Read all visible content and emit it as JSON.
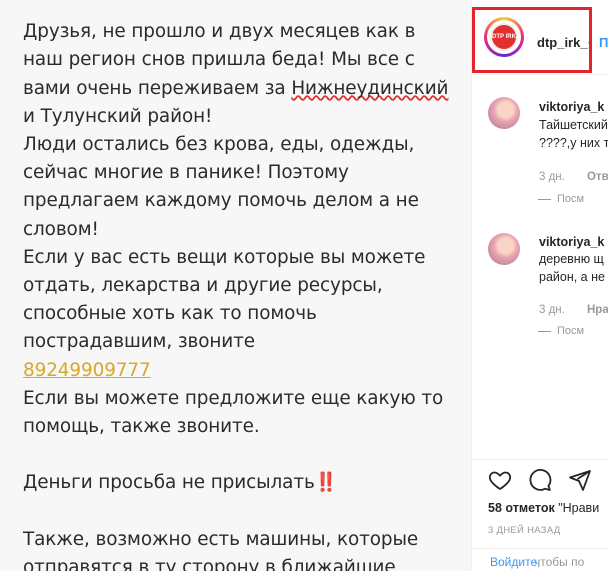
{
  "post": {
    "lines": [
      "Друзья, не прошло и двух месяцев как в",
      "наш регион снов пришла беда! Мы все с",
      "вами очень переживаем за ",
      "Нижнеудинский",
      "и Тулунский район!",
      "Люди остались без крова, еды, одежды,",
      "сейчас многие в панике! Поэтому",
      "предлагаем каждому помочь делом а не",
      "словом!",
      "Если у вас есть вещи которые вы можете",
      "отдать, лекарства и другие ресурсы,",
      "способные хоть как то помочь",
      "пострадавшим, звоните",
      "89249909777",
      "Если вы можете предложите еще какую то",
      "помощь, также звоните.",
      "Деньги просьба не присылать",
      "‼️",
      "Также, возможно есть машины, которые",
      "отправятся в ту сторону в ближайшие"
    ]
  },
  "header": {
    "username": "dtp_irk_",
    "separator": "•",
    "follow_label": "П",
    "avatar_logo_text": "DTP IRK"
  },
  "comments": [
    {
      "username": "viktoriya_k",
      "text_lines": [
        "Тайшетский",
        "????,у них т"
      ],
      "time": "3 дн.",
      "action": "Отв",
      "view_replies": "Посм"
    },
    {
      "username": "viktoriya_k",
      "text_lines": [
        "деревню щ",
        "район, а не"
      ],
      "time": "3 дн.",
      "action": "Нра",
      "view_replies": "Посм"
    }
  ],
  "actions": {
    "icons": [
      "heart-icon",
      "comment-icon",
      "share-icon"
    ],
    "likes_count": "58 отметок",
    "likes_rest": " \"Нрави",
    "time_ago": "3 ДНЕЙ НАЗАД",
    "login_link": "Войдите,",
    "login_rest": " чтобы по"
  }
}
